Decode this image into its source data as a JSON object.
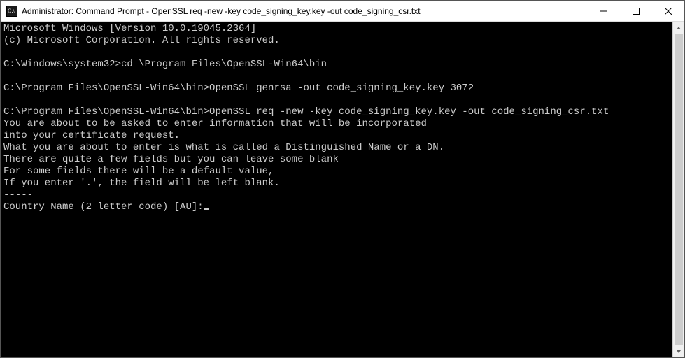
{
  "titlebar": {
    "title": "Administrator: Command Prompt - OpenSSL  req -new -key code_signing_key.key -out code_signing_csr.txt"
  },
  "terminal": {
    "lines": [
      "Microsoft Windows [Version 10.0.19045.2364]",
      "(c) Microsoft Corporation. All rights reserved.",
      "",
      "C:\\Windows\\system32>cd \\Program Files\\OpenSSL-Win64\\bin",
      "",
      "C:\\Program Files\\OpenSSL-Win64\\bin>OpenSSL genrsa -out code_signing_key.key 3072",
      "",
      "C:\\Program Files\\OpenSSL-Win64\\bin>OpenSSL req -new -key code_signing_key.key -out code_signing_csr.txt",
      "You are about to be asked to enter information that will be incorporated",
      "into your certificate request.",
      "What you are about to enter is what is called a Distinguished Name or a DN.",
      "There are quite a few fields but you can leave some blank",
      "For some fields there will be a default value,",
      "If you enter '.', the field will be left blank.",
      "-----",
      "Country Name (2 letter code) [AU]:"
    ]
  }
}
